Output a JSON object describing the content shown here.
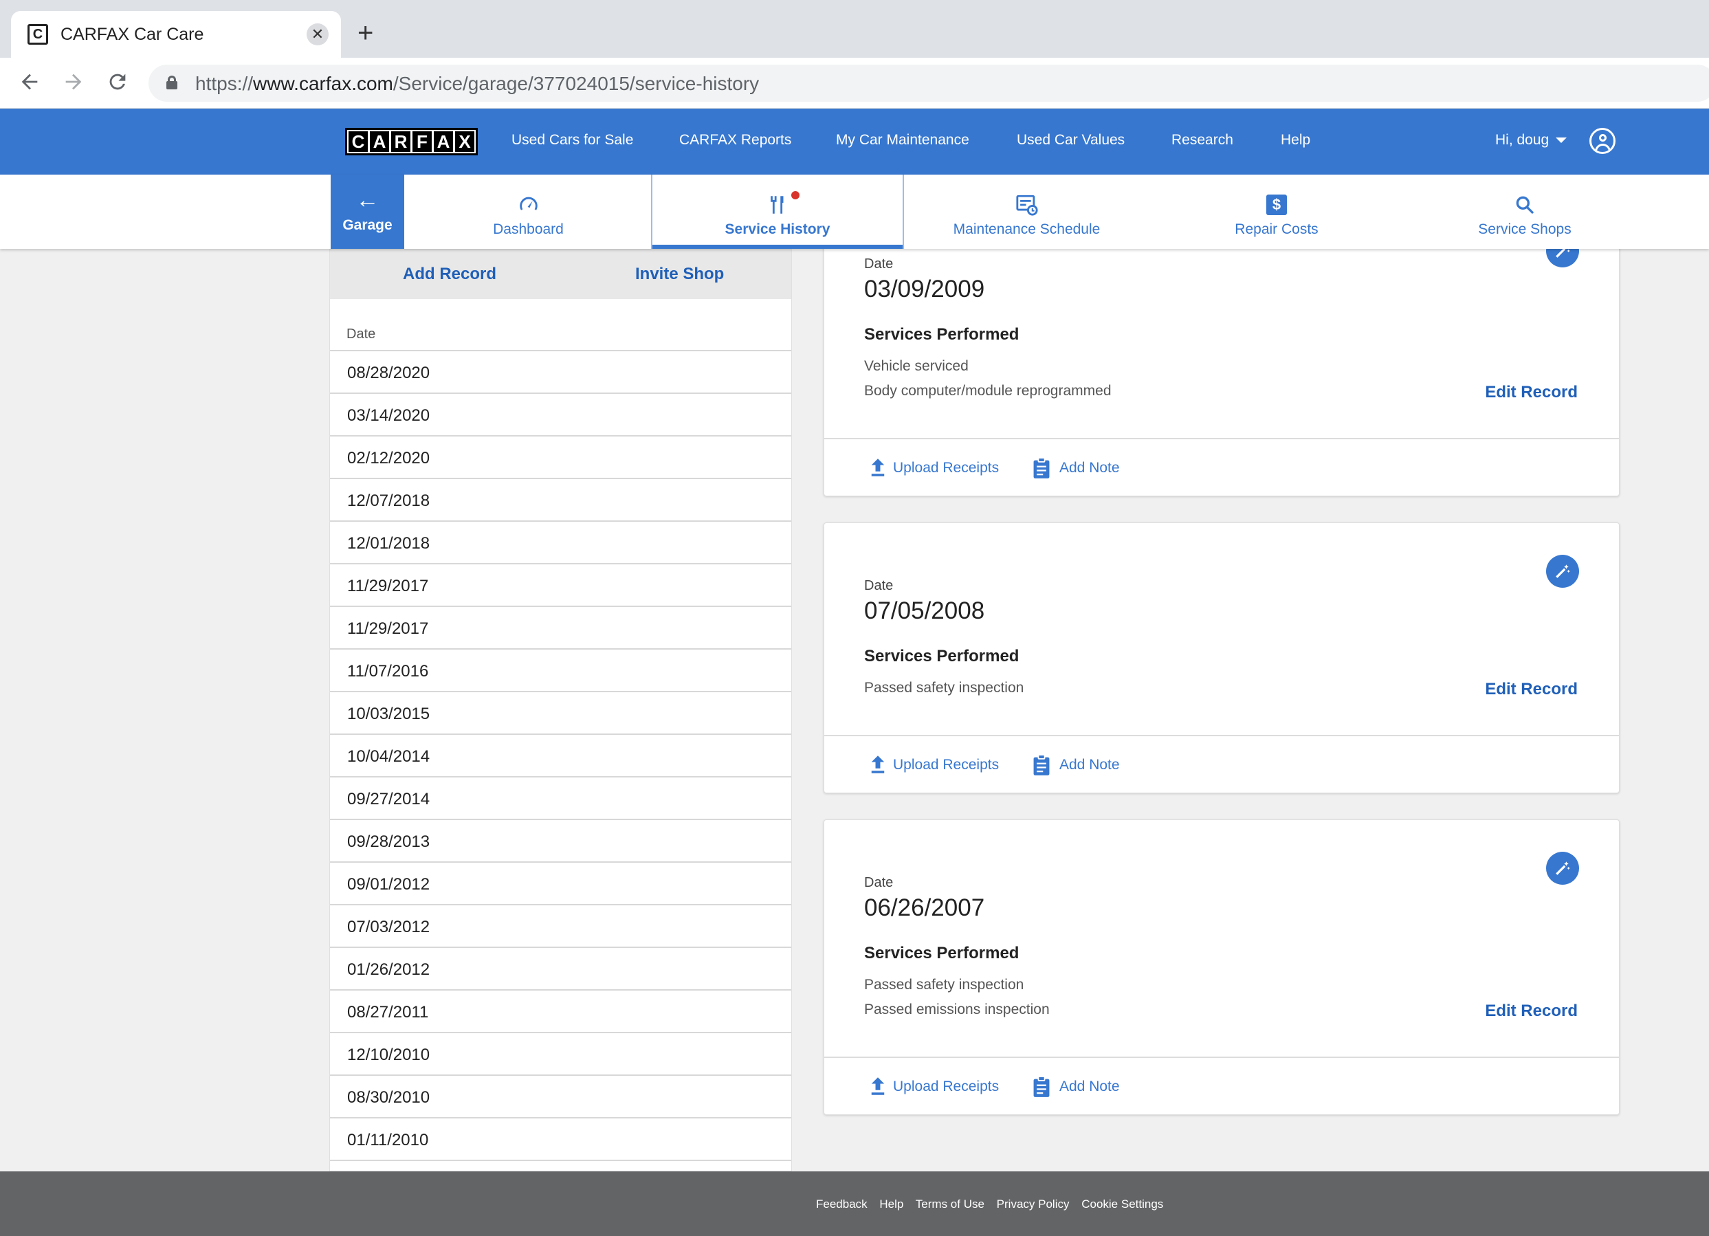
{
  "browser": {
    "tab_title": "CARFAX Car Care",
    "favicon_letter": "C",
    "close_glyph": "✕",
    "new_tab_glyph": "+",
    "url_scheme": "https://",
    "url_host": "www.carfax.com",
    "url_path": "/Service/garage/377024015/service-history"
  },
  "header": {
    "logo_letters": [
      "C",
      "A",
      "R",
      "F",
      "A",
      "X"
    ],
    "nav": [
      "Used Cars for Sale",
      "CARFAX Reports",
      "My Car Maintenance",
      "Used Car Values",
      "Research",
      "Help"
    ],
    "user_greeting": "Hi, doug"
  },
  "subnav": {
    "back_glyph": "←",
    "garage": "Garage",
    "tabs": [
      "Dashboard",
      "Service History",
      "Maintenance Schedule",
      "Repair Costs",
      "Service Shops"
    ],
    "active_tab": "Service History",
    "repair_costs_glyph": "$"
  },
  "left_panel": {
    "add_record": "Add Record",
    "invite_shop": "Invite Shop",
    "date_header": "Date",
    "dates": [
      "08/28/2020",
      "03/14/2020",
      "02/12/2020",
      "12/07/2018",
      "12/01/2018",
      "11/29/2017",
      "11/29/2017",
      "11/07/2016",
      "10/03/2015",
      "10/04/2014",
      "09/27/2014",
      "09/28/2013",
      "09/01/2012",
      "07/03/2012",
      "01/26/2012",
      "08/27/2011",
      "12/10/2010",
      "08/30/2010",
      "01/11/2010"
    ]
  },
  "records": [
    {
      "date_label": "Date",
      "date": "03/09/2009",
      "services_title": "Services Performed",
      "services": [
        "Vehicle serviced",
        "Body computer/module reprogrammed"
      ],
      "edit": "Edit Record",
      "upload": "Upload Receipts",
      "note": "Add Note"
    },
    {
      "date_label": "Date",
      "date": "07/05/2008",
      "services_title": "Services Performed",
      "services": [
        "Passed safety inspection"
      ],
      "edit": "Edit Record",
      "upload": "Upload Receipts",
      "note": "Add Note"
    },
    {
      "date_label": "Date",
      "date": "06/26/2007",
      "services_title": "Services Performed",
      "services": [
        "Passed safety inspection",
        "Passed emissions inspection"
      ],
      "edit": "Edit Record",
      "upload": "Upload Receipts",
      "note": "Add Note"
    }
  ],
  "footer": {
    "links": [
      "Feedback",
      "Help",
      "Terms of Use",
      "Privacy Policy",
      "Cookie Settings"
    ]
  },
  "colors": {
    "brand_blue": "#3777cf",
    "link_blue": "#1f5fb8",
    "footer_gray": "#636466",
    "notification_red": "#d9342b"
  }
}
